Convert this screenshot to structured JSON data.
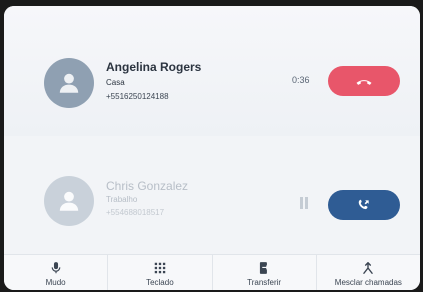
{
  "active_call": {
    "name": "Angelina Rogers",
    "label": "Casa",
    "number": "+5516250124188",
    "timer": "0:36",
    "action_icon": "hang-up-icon",
    "action_color": "#e8566a"
  },
  "held_call": {
    "name": "Chris Gonzalez",
    "label": "Trabalho",
    "number": "+554688018517",
    "status_icon": "pause-icon",
    "action_icon": "swap-call-icon",
    "action_color": "#2f5c94"
  },
  "toolbar": {
    "items": [
      {
        "label": "Mudo",
        "icon": "microphone-icon"
      },
      {
        "label": "Teclado",
        "icon": "keypad-icon"
      },
      {
        "label": "Transferir",
        "icon": "transfer-icon"
      },
      {
        "label": "Mesclar chamadas",
        "icon": "merge-calls-icon"
      }
    ]
  }
}
